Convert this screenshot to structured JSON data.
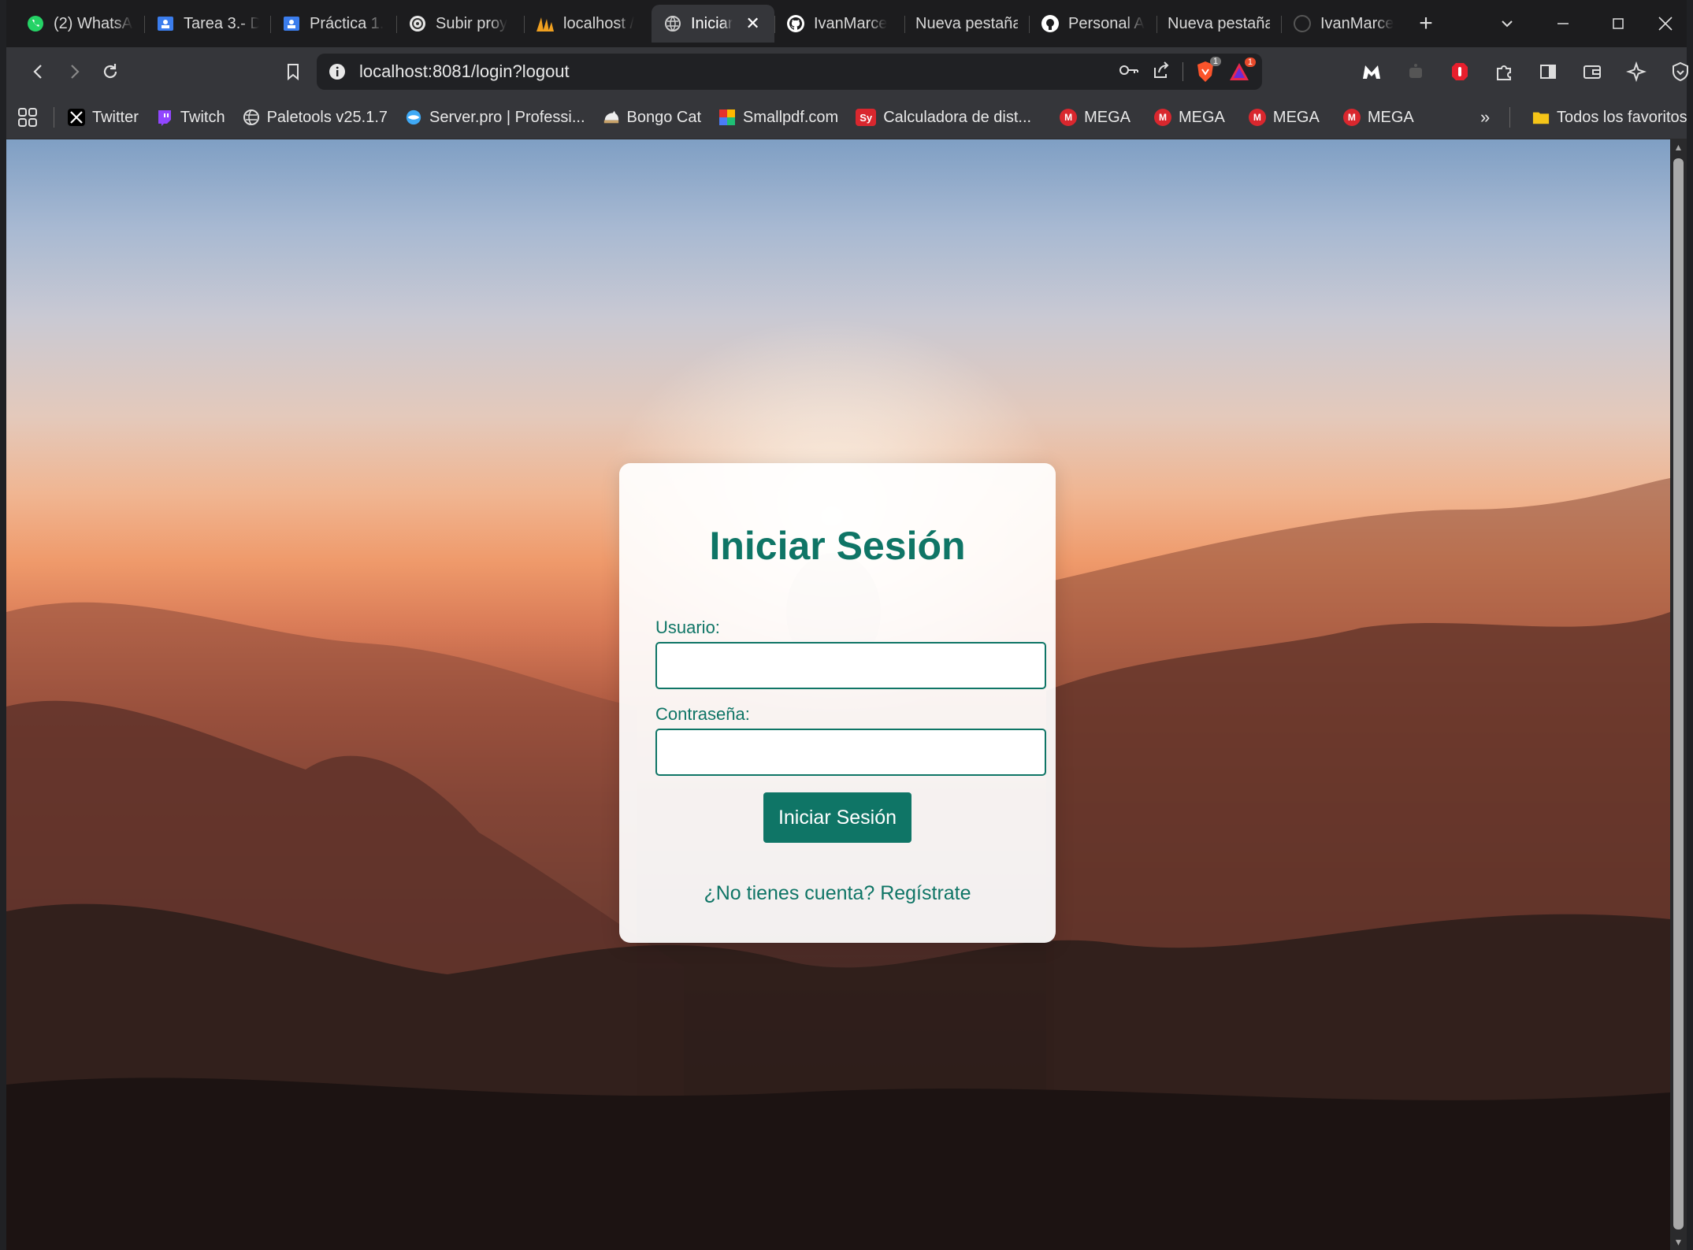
{
  "browser": {
    "tabs": [
      {
        "label": "(2) WhatsApp",
        "icon": "whatsapp-icon",
        "active": false
      },
      {
        "label": "Tarea 3.- D",
        "icon": "classroom-icon",
        "active": false
      },
      {
        "label": "Práctica 1.",
        "icon": "classroom-icon",
        "active": false
      },
      {
        "label": "Subir proy",
        "icon": "openai-icon",
        "active": false
      },
      {
        "label": "localhost /",
        "icon": "phpmyadmin-icon",
        "active": false
      },
      {
        "label": "Iniciar",
        "icon": "globe-icon",
        "active": true
      },
      {
        "label": "IvanMarce",
        "icon": "github-icon",
        "active": false
      },
      {
        "label": "Nueva pestaña",
        "icon": "",
        "active": false
      },
      {
        "label": "Personal A",
        "icon": "github-icon",
        "active": false
      },
      {
        "label": "Nueva pestaña",
        "icon": "",
        "active": false
      },
      {
        "label": "IvanMarce",
        "icon": "github-icon",
        "active": false
      }
    ],
    "new_tab": "+",
    "url": "localhost:8081/login?logout",
    "badges": {
      "brave_shields": "1",
      "brave_rewards": "1"
    },
    "bookmarks": [
      {
        "label": "Twitter",
        "icon": "x-icon"
      },
      {
        "label": "Twitch",
        "icon": "twitch-icon"
      },
      {
        "label": "Paletools v25.1.7",
        "icon": "globe-icon"
      },
      {
        "label": "Server.pro | Professi...",
        "icon": "serverpro-icon"
      },
      {
        "label": "Bongo Cat",
        "icon": "bongo-cat-icon"
      },
      {
        "label": "Smallpdf.com",
        "icon": "smallpdf-icon"
      },
      {
        "label": "Calculadora de dist...",
        "icon": "calculator-icon",
        "icon_text": "Sy"
      },
      {
        "label": "MEGA",
        "icon": "mega-icon",
        "icon_text": "M"
      },
      {
        "label": "MEGA",
        "icon": "mega-icon",
        "icon_text": "M"
      },
      {
        "label": "MEGA",
        "icon": "mega-icon",
        "icon_text": "M"
      },
      {
        "label": "MEGA",
        "icon": "mega-icon",
        "icon_text": "M"
      }
    ],
    "more_bookmarks": "»",
    "all_bookmarks": "Todos los favoritos"
  },
  "login": {
    "title": "Iniciar Sesión",
    "username_label": "Usuario:",
    "username_value": "",
    "password_label": "Contraseña:",
    "password_value": "",
    "submit_label": "Iniciar Sesión",
    "register_link": "¿No tienes cuenta? Regístrate"
  },
  "colors": {
    "accent": "#0f7566",
    "browser_frame": "#35363a",
    "tab_strip": "#1c1c1e"
  }
}
